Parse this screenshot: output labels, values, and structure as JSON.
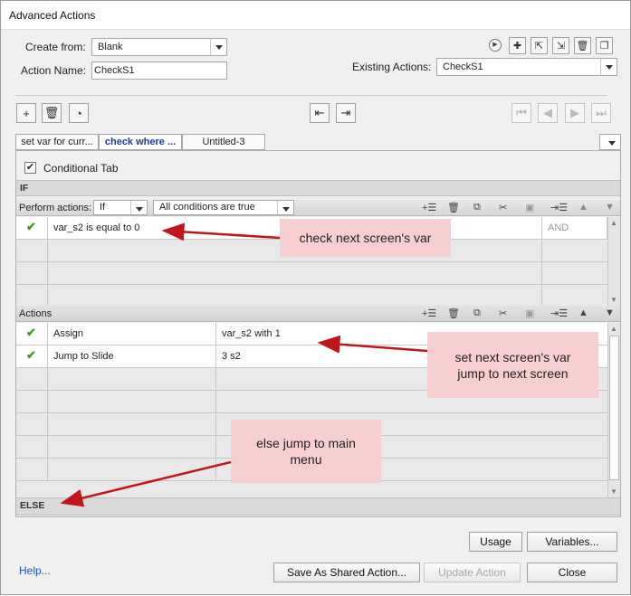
{
  "window": {
    "title": "Advanced Actions"
  },
  "form": {
    "create_from_label": "Create from:",
    "create_from_value": "Blank",
    "action_name_label": "Action Name:",
    "action_name_value": "CheckS1",
    "existing_actions_label": "Existing Actions:",
    "existing_actions_value": "CheckS1"
  },
  "tabs": [
    "set var for curr...",
    "check where ...",
    "Untitled-3"
  ],
  "conditional_tab_label": "Conditional Tab",
  "conditional_tab_checked": true,
  "if_section": {
    "label": "IF",
    "perform_actions_label": "Perform actions:",
    "perform_value": "If",
    "conditions_value": "All conditions are true",
    "rows": [
      {
        "checked": true,
        "condition": "var_s2   is equal to    0",
        "operator": "AND"
      }
    ]
  },
  "actions_section": {
    "label": "Actions",
    "rows": [
      {
        "checked": true,
        "action": "Assign",
        "target": "var_s2    with    1"
      },
      {
        "checked": true,
        "action": "Jump to Slide",
        "target": "3 s2"
      }
    ]
  },
  "else_label": "ELSE",
  "callouts": {
    "check_var": "check next screen's var",
    "set_var": "set next screen's var jump to next screen",
    "else_jump": "else jump to main menu"
  },
  "buttons": {
    "usage": "Usage",
    "variables": "Variables...",
    "help": "Help...",
    "save_shared": "Save As Shared Action...",
    "update": "Update Action",
    "close": "Close"
  },
  "colors": {
    "check": "#3e9b1e",
    "callout_bg": "#f8cfd0",
    "arrow": "#c0161b",
    "link": "#1b53c2",
    "active_tab": "#1a3aa8"
  }
}
